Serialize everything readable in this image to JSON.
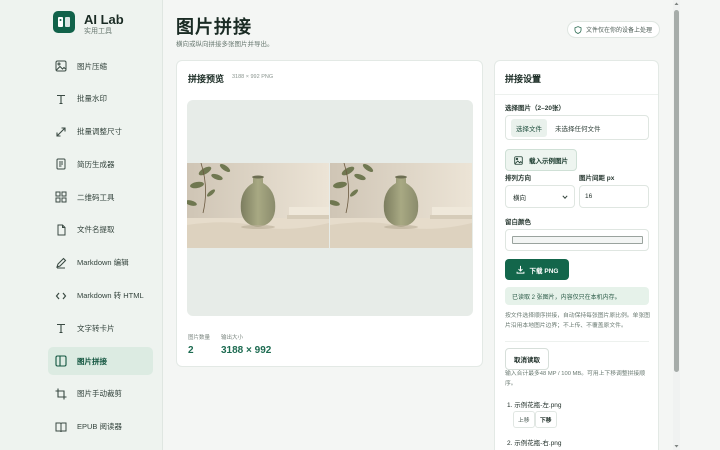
{
  "brand": {
    "name": "AI Lab",
    "subtitle": "实用工具"
  },
  "nav": {
    "items": [
      {
        "label": "图片压缩",
        "icon": "image-icon"
      },
      {
        "label": "批量水印",
        "icon": "text-t-icon"
      },
      {
        "label": "批量调整尺寸",
        "icon": "resize-arrows-icon"
      },
      {
        "label": "简历生成器",
        "icon": "document-icon"
      },
      {
        "label": "二维码工具",
        "icon": "grid-icon"
      },
      {
        "label": "文件名提取",
        "icon": "file-icon"
      },
      {
        "label": "Markdown 编辑",
        "icon": "pen-icon"
      },
      {
        "label": "Markdown 转 HTML",
        "icon": "code-icon"
      },
      {
        "label": "文字转卡片",
        "icon": "text-t-icon"
      },
      {
        "label": "图片拼接",
        "icon": "split-panel-icon",
        "active": true
      },
      {
        "label": "图片手动裁剪",
        "icon": "crop-icon"
      },
      {
        "label": "EPUB 阅读器",
        "icon": "book-icon"
      }
    ]
  },
  "header": {
    "title": "图片拼接",
    "subtitle": "横向或纵向拼接多张图片并导出。",
    "privacy": "文件仅在你的设备上处理"
  },
  "preview": {
    "title": "拼接预览",
    "meta": "3188 × 992 PNG",
    "stats": [
      {
        "label": "图片数量",
        "value": "2"
      },
      {
        "label": "输出大小",
        "value": "3188 × 992"
      }
    ]
  },
  "settings": {
    "title": "拼接设置",
    "select_images_label": "选择图片（2–20张）",
    "choose_file_button": "选择文件",
    "no_file_text": "未选择任何文件",
    "sample_button": "载入示例图片",
    "direction_label": "排列方向",
    "direction_value": "横向",
    "gap_label": "图片间距 px",
    "gap_value": "16",
    "bg_label": "留白颜色",
    "bg_color": "#f3f5f4",
    "download_button": "下载 PNG",
    "status": "已读取 2 张图片，内容仅只在本机内存。",
    "help": "按文件选择顺序拼接，自动保持每张图片原比例。单张图片沿用本地图片边界；不上传、不覆盖原文件。",
    "cancel_button": "取消读取",
    "limit_help": "输入合计最多48 MP / 100 MB。可用上下移调整拼接顺序。",
    "files": [
      {
        "name": "1. 示例花瓶-左.png",
        "up": "上移",
        "down": "下移"
      },
      {
        "name": "2. 示例花瓶-右.png"
      }
    ]
  },
  "colors": {
    "accent": "#13664b",
    "sidebar_bg": "#eef3ef",
    "page_bg": "#f4f6f4"
  }
}
